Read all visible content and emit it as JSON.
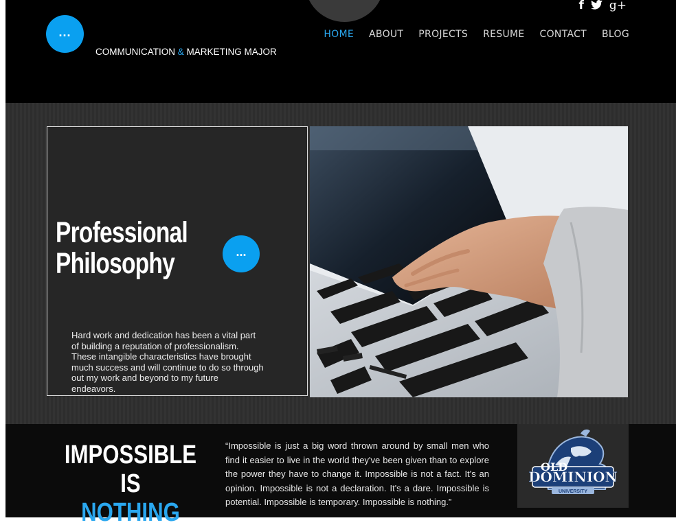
{
  "header": {
    "logo_label": "...",
    "tagline_part1": "COMMUNICATION ",
    "tagline_amp": "&",
    "tagline_part2": " MARKETING MAJOR",
    "social": {
      "facebook": "f",
      "twitter": "t",
      "google": "g+"
    },
    "nav": [
      "HOME",
      "ABOUT",
      "PROJECTS",
      "RESUME",
      "CONTACT",
      "BLOG"
    ],
    "active_nav": "HOME"
  },
  "philosophy": {
    "title_line1": "Professional",
    "title_line2": "Philosophy",
    "button_label": "...",
    "text": "Hard work and dedication has been a vital part of building a reputation of professionalism. These intangible characteristics have brought much success and will continue to do so through out my work and beyond to my future endeavors."
  },
  "impossible": {
    "line1": "IMPOSSIBLE IS",
    "line2": "NOTHING",
    "quote": "“Impossible is just a big word thrown around by small men who find it easier to live in the world they've been given than to explore the power they have to change it. Impossible is not a fact. It's an opinion. Impossible is not a declaration. It's a dare. Impossible is potential. Impossible is temporary. Impossible is nothing.”"
  },
  "logo": {
    "line1": "OLD",
    "line2": "DOMINION",
    "line3": "UNIVERSITY"
  },
  "colors": {
    "accent": "#2aa7ef",
    "header_bg": "#000000",
    "card_bg": "#262626"
  }
}
